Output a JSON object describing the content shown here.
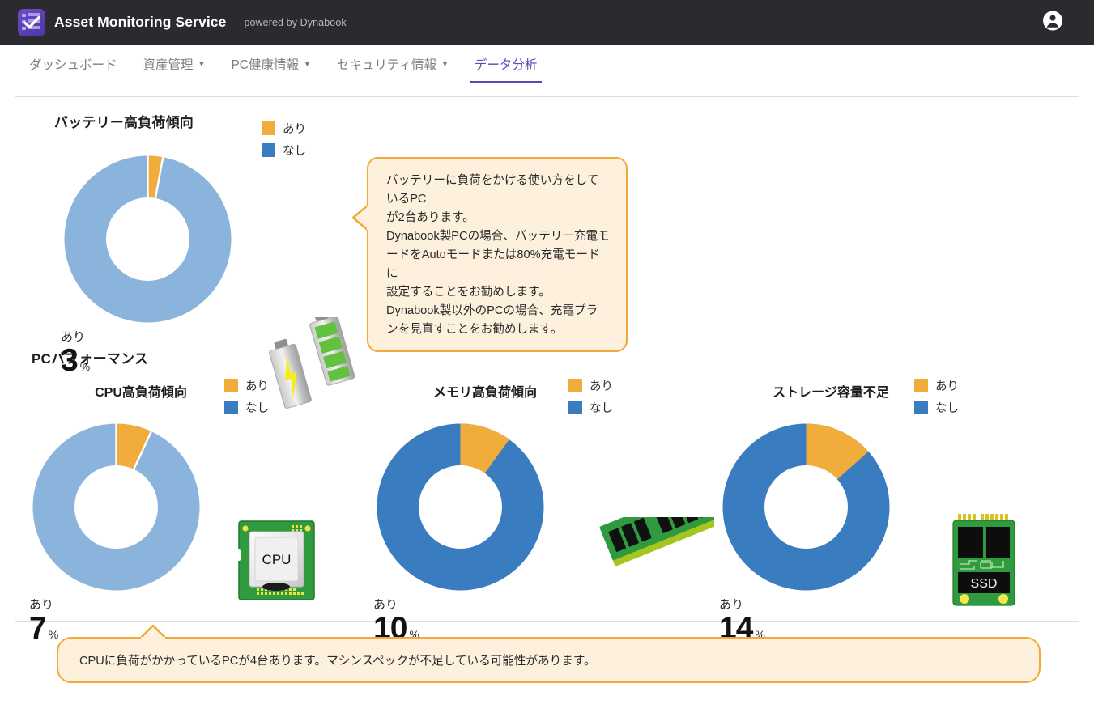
{
  "header": {
    "logo_name": "checklist-logo",
    "app_title": "Asset Monitoring Service",
    "powered_by": "powered by Dynabook",
    "account_icon": "account-circle-icon"
  },
  "nav": {
    "items": [
      {
        "label": "ダッシュボード",
        "has_caret": false,
        "active": false
      },
      {
        "label": "資産管理",
        "has_caret": true,
        "active": false
      },
      {
        "label": "PC健康情報",
        "has_caret": true,
        "active": false
      },
      {
        "label": "セキュリティ情報",
        "has_caret": true,
        "active": false
      },
      {
        "label": "データ分析",
        "has_caret": false,
        "active": true
      }
    ],
    "caret_glyph": "▼",
    "active_color": "#5b4bb7",
    "inactive_color": "#7c7c82"
  },
  "battery_section": {
    "title": "バッテリー高負荷傾向",
    "legend": [
      {
        "label": "あり",
        "color": "#f0ad3c"
      },
      {
        "label": "なし",
        "color": "#3a7cc0"
      }
    ],
    "center_label": "あり",
    "center_value": "3",
    "center_unit": "%",
    "icon": "battery-pair-icon",
    "callout": "バッテリーに負荷をかける使い方をしているPC\nが2台あります。\nDynabook製PCの場合、バッテリー充電モ\nードをAutoモードまたは80%充電モードに\n設定することをお勧めします。\nDynabook製以外のPCの場合、充電プラ\nンを見直すことをお勧めします。"
  },
  "performance_section": {
    "title": "PCパフォーマンス",
    "charts": [
      {
        "title": "CPU高負荷傾向",
        "center_label": "あり",
        "center_value": "7",
        "center_unit": "%",
        "icon": "cpu-chip-icon",
        "icon_text": "CPU"
      },
      {
        "title": "メモリ高負荷傾向",
        "center_label": "あり",
        "center_value": "10",
        "center_unit": "%",
        "icon": "ram-module-icon",
        "icon_text": ""
      },
      {
        "title": "ストレージ容量不足",
        "center_label": "あり",
        "center_value": "14",
        "center_unit": "%",
        "icon": "ssd-drive-icon",
        "icon_text": "SSD"
      }
    ],
    "legend": [
      {
        "label": "あり",
        "color": "#f0ad3c"
      },
      {
        "label": "なし",
        "color": "#3a7cc0"
      }
    ],
    "banner": "CPUに負荷がかかっているPCが4台あります。マシンスペックが不足している可能性があります。"
  },
  "chart_data": [
    {
      "type": "pie",
      "title": "バッテリー高負荷傾向",
      "labels": [
        "あり",
        "なし"
      ],
      "values": [
        3,
        97
      ],
      "colors": [
        "#f0ad3c",
        "#8ab4dc"
      ],
      "unit": "%",
      "donut": true,
      "legend_position": "top-right",
      "center_text": "あり 3%"
    },
    {
      "type": "pie",
      "title": "CPU高負荷傾向",
      "labels": [
        "あり",
        "なし"
      ],
      "values": [
        7,
        93
      ],
      "colors": [
        "#f0ad3c",
        "#8ab4dc"
      ],
      "unit": "%",
      "donut": true,
      "legend_position": "top-right",
      "center_text": "あり 7%"
    },
    {
      "type": "pie",
      "title": "メモリ高負荷傾向",
      "labels": [
        "あり",
        "なし"
      ],
      "values": [
        10,
        90
      ],
      "colors": [
        "#f0ad3c",
        "#3a7cc0"
      ],
      "unit": "%",
      "donut": true,
      "legend_position": "top-right",
      "center_text": "あり 10%"
    },
    {
      "type": "pie",
      "title": "ストレージ容量不足",
      "labels": [
        "あり",
        "なし"
      ],
      "values": [
        14,
        86
      ],
      "colors": [
        "#f0ad3c",
        "#3a7cc0"
      ],
      "unit": "%",
      "donut": true,
      "legend_position": "top-right",
      "center_text": "あり 14%"
    }
  ]
}
